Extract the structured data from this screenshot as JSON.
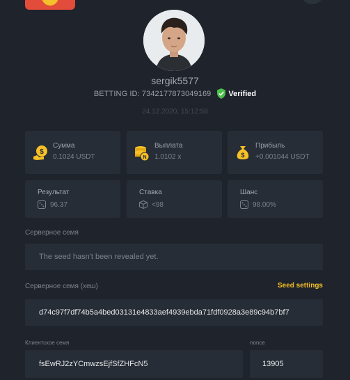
{
  "profile": {
    "username": "sergik5577",
    "betting_id_label": "BETTING ID: 7342177873049169",
    "verified_label": "Verified",
    "timestamp": "24.12.2020, 15:12:58"
  },
  "stats": [
    {
      "label": "Сумма",
      "value": "0.1024 USDT",
      "icon": "coins-icon"
    },
    {
      "label": "Выплата",
      "value": "1.0102 x",
      "icon": "coin-stack-icon"
    },
    {
      "label": "Прибыль",
      "value": "+0.001044 USDT",
      "icon": "money-bag-icon"
    }
  ],
  "results": [
    {
      "label": "Результат",
      "value": "96.37",
      "icon": "dice-icon"
    },
    {
      "label": "Ставка",
      "value": "<98",
      "icon": "dice-cube-icon"
    },
    {
      "label": "Шанс",
      "value": "98.00%",
      "icon": "dice-icon"
    }
  ],
  "server_seed": {
    "label": "Серверное семя",
    "value": "The seed hasn't been revealed yet."
  },
  "server_seed_hash": {
    "label": "Серверное семя (хеш)",
    "settings_link": "Seed settings",
    "value": "d74c97f7df74b5a4bed03131e4833aef4939ebda71fdf0928a3e89c94b7bf7"
  },
  "client_seed": {
    "label": "Клиентское семя",
    "value": "fsEwRJ2zYCmwzsEjfSfZHFcN5"
  },
  "nonce": {
    "label": "nonce",
    "value": "13905"
  },
  "colors": {
    "background": "#1f242c",
    "card": "#272d36",
    "accent_yellow": "#f6c026",
    "verified_green": "#4cc04a"
  }
}
